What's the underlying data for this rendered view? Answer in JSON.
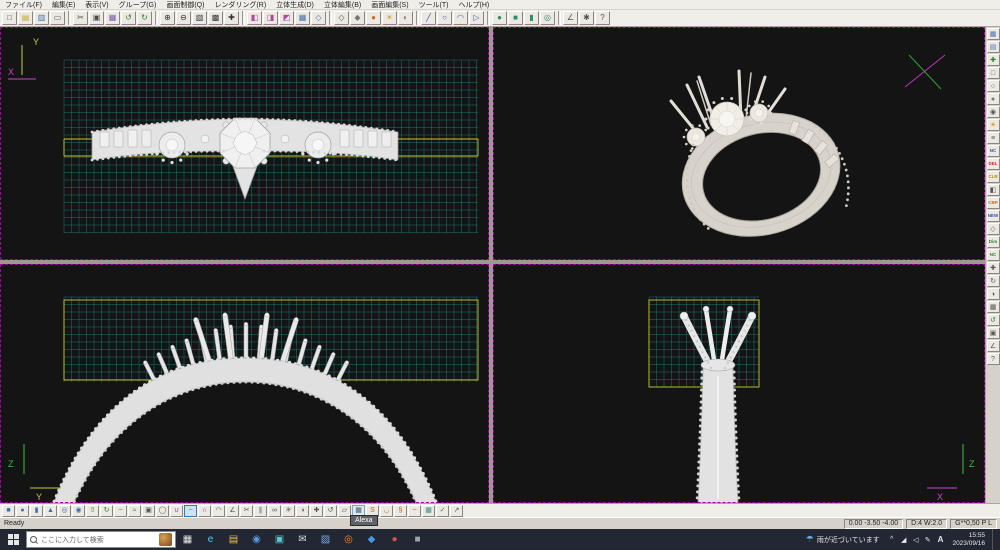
{
  "menubar": {
    "items": [
      {
        "id": "file",
        "label": "ファイル(F)"
      },
      {
        "id": "edit",
        "label": "編集(E)"
      },
      {
        "id": "view",
        "label": "表示(V)"
      },
      {
        "id": "group",
        "label": "グループ(G)"
      },
      {
        "id": "screen-control",
        "label": "画面制御(Q)"
      },
      {
        "id": "rendering",
        "label": "レンダリング(R)"
      },
      {
        "id": "solid-create",
        "label": "立体生成(D)"
      },
      {
        "id": "solid-edit",
        "label": "立体編集(B)"
      },
      {
        "id": "screen-edit",
        "label": "画面編集(S)"
      },
      {
        "id": "tools",
        "label": "ツール(T)"
      },
      {
        "id": "help",
        "label": "ヘルプ(H)"
      }
    ]
  },
  "top_toolbar": {
    "icons": [
      {
        "name": "new-file",
        "glyph": "□",
        "color": "#4a4a4a"
      },
      {
        "name": "open-file",
        "glyph": "▤",
        "color": "#c9a227"
      },
      {
        "name": "save-file",
        "glyph": "▥",
        "color": "#3a6fb0"
      },
      {
        "name": "print",
        "glyph": "▭",
        "color": "#4a4a4a"
      },
      {
        "sep": true
      },
      {
        "name": "cut",
        "glyph": "✂",
        "color": "#4a4a4a"
      },
      {
        "name": "copy",
        "glyph": "▣",
        "color": "#4a4a4a"
      },
      {
        "name": "paste",
        "glyph": "▦",
        "color": "#7a5ab0"
      },
      {
        "name": "undo",
        "glyph": "↺",
        "color": "#2e7d32"
      },
      {
        "name": "redo",
        "glyph": "↻",
        "color": "#2e7d32"
      },
      {
        "sep": true
      },
      {
        "name": "zoom-in",
        "glyph": "⊕",
        "color": "#333333"
      },
      {
        "name": "zoom-out",
        "glyph": "⊖",
        "color": "#333333"
      },
      {
        "name": "zoom-window",
        "glyph": "▧",
        "color": "#333333"
      },
      {
        "name": "zoom-fit",
        "glyph": "▩",
        "color": "#333333"
      },
      {
        "name": "pan",
        "glyph": "✚",
        "color": "#333333"
      },
      {
        "sep": true
      },
      {
        "name": "view-front",
        "glyph": "◧",
        "color": "#b04aa0"
      },
      {
        "name": "view-top",
        "glyph": "◨",
        "color": "#b04aa0"
      },
      {
        "name": "view-side",
        "glyph": "◩",
        "color": "#b04aa0"
      },
      {
        "name": "view-quad",
        "glyph": "▦",
        "color": "#4a6fb0"
      },
      {
        "name": "view-perspective",
        "glyph": "◇",
        "color": "#4a6fb0"
      },
      {
        "sep": true
      },
      {
        "name": "wireframe",
        "glyph": "◇",
        "color": "#555555"
      },
      {
        "name": "shaded",
        "glyph": "◆",
        "color": "#777777"
      },
      {
        "name": "render",
        "glyph": "●",
        "color": "#d06a2c"
      },
      {
        "name": "light",
        "glyph": "☀",
        "color": "#d09a2c"
      },
      {
        "name": "material",
        "glyph": "◐",
        "color": "#777777"
      },
      {
        "sep": true
      },
      {
        "name": "line",
        "glyph": "╱",
        "color": "#3355aa"
      },
      {
        "name": "circle",
        "glyph": "○",
        "color": "#3355aa"
      },
      {
        "name": "arc",
        "glyph": "◠",
        "color": "#3355aa"
      },
      {
        "name": "polyline",
        "glyph": "▷",
        "color": "#3355aa"
      },
      {
        "sep": true
      },
      {
        "name": "sphere",
        "glyph": "●",
        "color": "#2e8b6f"
      },
      {
        "name": "box",
        "glyph": "■",
        "color": "#2e8b6f"
      },
      {
        "name": "cylinder",
        "glyph": "▮",
        "color": "#2e8b6f"
      },
      {
        "name": "torus",
        "glyph": "◎",
        "color": "#2e8b6f"
      },
      {
        "sep": true
      },
      {
        "name": "measure",
        "glyph": "∠",
        "color": "#555555"
      },
      {
        "name": "settings",
        "glyph": "✱",
        "color": "#555555"
      },
      {
        "name": "help",
        "glyph": "?",
        "color": "#555555"
      }
    ]
  },
  "right_toolbar": {
    "buttons": [
      {
        "name": "snap",
        "glyph": "▦",
        "color": "#4a6fb0"
      },
      {
        "name": "grid-toggle",
        "glyph": "▤",
        "color": "#4a6fb0"
      },
      {
        "name": "axis",
        "glyph": "✚",
        "color": "#2e7d32"
      },
      {
        "name": "select",
        "glyph": "□",
        "color": "#555555"
      },
      {
        "name": "lasso",
        "glyph": "○",
        "color": "#555555"
      },
      {
        "name": "hide",
        "glyph": "●",
        "color": "#777777"
      },
      {
        "name": "camera",
        "glyph": "◉",
        "color": "#555555"
      },
      {
        "name": "light",
        "glyph": "☀",
        "color": "#c98f1f"
      },
      {
        "name": "layers",
        "glyph": "≡",
        "color": "#555555"
      },
      {
        "name": "nc",
        "label": "NC",
        "color": "#2e55b0"
      },
      {
        "name": "delete",
        "label": "DEL",
        "color": "#cc2222"
      },
      {
        "name": "clear",
        "label": "CLR",
        "color": "#b08a00"
      },
      {
        "name": "mask",
        "glyph": "◧",
        "color": "#555555"
      },
      {
        "name": "cbp",
        "label": "CBP",
        "color": "#d0681f"
      },
      {
        "name": "new",
        "label": "NEW",
        "color": "#2e55b0"
      },
      {
        "name": "wire",
        "glyph": "◇",
        "color": "#555555"
      },
      {
        "name": "dim",
        "label": "Dim",
        "color": "#2e7d32"
      },
      {
        "name": "nc-scale",
        "label": "NC",
        "color": "#2e7d32"
      },
      {
        "name": "move",
        "glyph": "✚",
        "color": "#555555"
      },
      {
        "name": "rotate",
        "glyph": "↻",
        "color": "#555555"
      },
      {
        "name": "mirror",
        "glyph": "◑",
        "color": "#555555"
      },
      {
        "name": "array",
        "glyph": "▦",
        "color": "#555555"
      },
      {
        "name": "undo",
        "glyph": "↺",
        "color": "#2e7d32"
      },
      {
        "name": "fit",
        "glyph": "▣",
        "color": "#555555"
      },
      {
        "name": "measure",
        "glyph": "∠",
        "color": "#555555"
      },
      {
        "name": "help",
        "glyph": "?",
        "color": "#555555"
      }
    ]
  },
  "bottom_toolbar": {
    "icons": [
      {
        "name": "prim-box",
        "glyph": "■",
        "color": "#3a6fb0"
      },
      {
        "name": "prim-sphere",
        "glyph": "●",
        "color": "#3a6fb0"
      },
      {
        "name": "prim-cylinder",
        "glyph": "▮",
        "color": "#3a6fb0"
      },
      {
        "name": "prim-cone",
        "glyph": "▲",
        "color": "#3a6fb0"
      },
      {
        "name": "prim-torus",
        "glyph": "◎",
        "color": "#3a6fb0"
      },
      {
        "name": "prim-tube",
        "glyph": "◉",
        "color": "#3a6fb0"
      },
      {
        "name": "extrude",
        "glyph": "⇧",
        "color": "#2e7d32"
      },
      {
        "name": "revolve",
        "glyph": "↻",
        "color": "#2e7d32"
      },
      {
        "name": "sweep",
        "glyph": "~",
        "color": "#2e7d32"
      },
      {
        "name": "loft",
        "glyph": "≈",
        "color": "#2e7d32"
      },
      {
        "name": "shell",
        "glyph": "▣",
        "color": "#555555"
      },
      {
        "name": "offset",
        "glyph": "◯",
        "color": "#555555"
      },
      {
        "name": "boolean-union",
        "glyph": "∪",
        "color": "#8a4ab0"
      },
      {
        "name": "boolean-subtract",
        "glyph": "−",
        "color": "#8a4ab0",
        "selected": true
      },
      {
        "name": "boolean-intersect",
        "glyph": "∩",
        "color": "#8a4ab0"
      },
      {
        "name": "fillet",
        "glyph": "◠",
        "color": "#555555"
      },
      {
        "name": "chamfer",
        "glyph": "∠",
        "color": "#555555"
      },
      {
        "name": "trim",
        "glyph": "✂",
        "color": "#555555"
      },
      {
        "name": "split",
        "glyph": "∥",
        "color": "#555555"
      },
      {
        "name": "join",
        "glyph": "∞",
        "color": "#555555"
      },
      {
        "name": "explode",
        "glyph": "✳",
        "color": "#555555"
      },
      {
        "name": "mirror",
        "glyph": "◑",
        "color": "#555555"
      },
      {
        "name": "move",
        "glyph": "✚",
        "color": "#555555"
      },
      {
        "name": "rotate",
        "glyph": "↺",
        "color": "#555555"
      },
      {
        "name": "scale",
        "glyph": "▱",
        "color": "#555555"
      },
      {
        "name": "array",
        "glyph": "▦",
        "color": "#555555",
        "hover": true
      },
      {
        "name": "deform",
        "glyph": "S",
        "color": "#b0662a"
      },
      {
        "name": "bend",
        "glyph": "◡",
        "color": "#b0662a"
      },
      {
        "name": "twist",
        "glyph": "§",
        "color": "#b0662a"
      },
      {
        "name": "smooth",
        "glyph": "~",
        "color": "#b0662a"
      },
      {
        "name": "mesh",
        "glyph": "▦",
        "color": "#3a8a8a"
      },
      {
        "name": "check",
        "glyph": "✓",
        "color": "#2e7d32"
      },
      {
        "name": "export",
        "glyph": "↗",
        "color": "#555555"
      }
    ]
  },
  "viewports": {
    "front": {
      "axes": {
        "v": "Y",
        "h": "X"
      }
    },
    "perspective": {},
    "side": {
      "axes": {
        "v": "Z",
        "h": "Y"
      }
    },
    "edge": {
      "axes": {
        "v": "Z",
        "h": "X"
      }
    }
  },
  "colors": {
    "grid": "#1e8585",
    "guide": "#c9c92e",
    "viewport_border": "#a800a8",
    "axis_y": "#cccc33",
    "axis_x": "#cc44cc",
    "axis_z": "#44bb44"
  },
  "tooltip": {
    "text": "Alexa"
  },
  "statusbar": {
    "ready": "Ready",
    "coords": "0.00  -3.50  -4.00",
    "dims": "D:4 W:2.0",
    "grid": "G**0,50 P   L"
  },
  "taskbar": {
    "search": {
      "placeholder": "ここに入力して検索"
    },
    "pinned": [
      {
        "name": "task-view",
        "glyph": "▦",
        "color": "#e8e8e8"
      },
      {
        "name": "app-edge",
        "glyph": "e",
        "color": "#4ec9f5"
      },
      {
        "name": "app-explorer",
        "glyph": "▤",
        "color": "#e8c34a"
      },
      {
        "name": "app-chrome",
        "glyph": "◉",
        "color": "#5a9ae0"
      },
      {
        "name": "app-store",
        "glyph": "▣",
        "color": "#58c7d0"
      },
      {
        "name": "app-mail",
        "glyph": "✉",
        "color": "#d8dee5"
      },
      {
        "name": "app-photos",
        "glyph": "▨",
        "color": "#7aa7e8"
      },
      {
        "name": "app-firefox",
        "glyph": "◎",
        "color": "#f08a3c"
      },
      {
        "name": "app-vscode",
        "glyph": "◆",
        "color": "#3f9ae0"
      },
      {
        "name": "app-red",
        "glyph": "●",
        "color": "#d05050"
      },
      {
        "name": "app-gray",
        "glyph": "■",
        "color": "#9aa2ac"
      }
    ],
    "weather": {
      "text": "雨が近づいています"
    },
    "tray": [
      {
        "name": "tray-expand",
        "glyph": "^"
      },
      {
        "name": "network",
        "glyph": "◢"
      },
      {
        "name": "volume",
        "glyph": "◁"
      },
      {
        "name": "pen",
        "glyph": "✎"
      }
    ],
    "ime": "A",
    "clock": {
      "time": "15:55",
      "date": "2023/09/16"
    }
  }
}
